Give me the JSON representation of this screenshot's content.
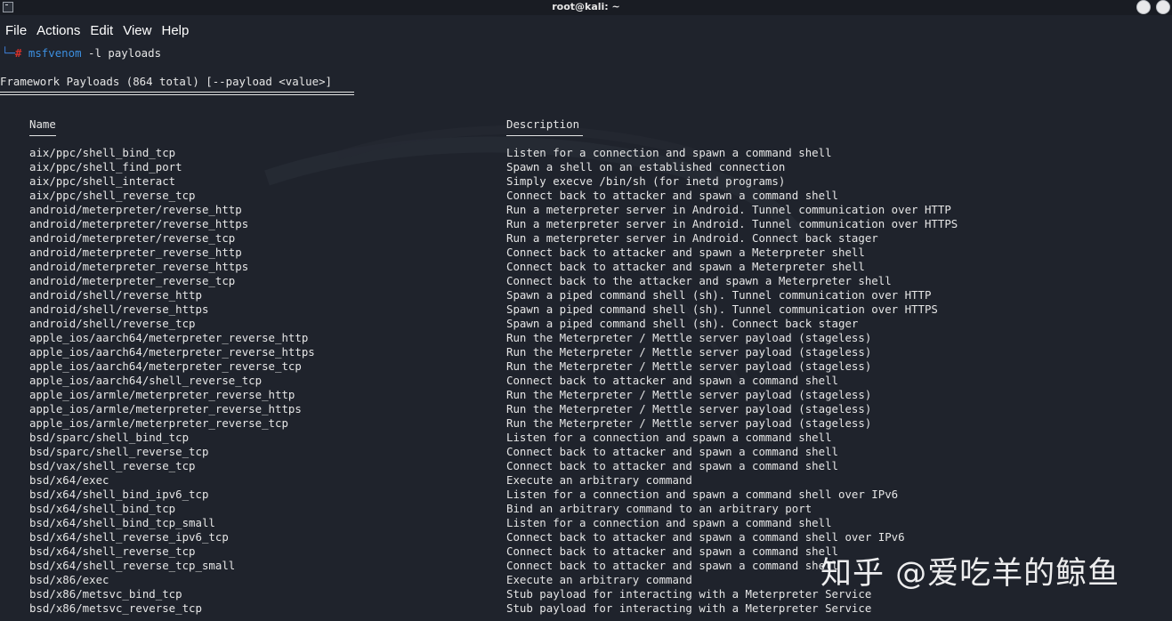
{
  "window": {
    "title": "root@kali: ~"
  },
  "menu": {
    "items": [
      "File",
      "Actions",
      "Edit",
      "View",
      "Help"
    ]
  },
  "prompt": {
    "corner": "└─",
    "hash": "#",
    "command": "msfvenom",
    "args": " -l payloads"
  },
  "output": {
    "heading": "Framework Payloads (864 total) [--payload <value>]",
    "columns": {
      "name": "Name",
      "description": "Description"
    },
    "rows": [
      [
        "aix/ppc/shell_bind_tcp",
        "Listen for a connection and spawn a command shell"
      ],
      [
        "aix/ppc/shell_find_port",
        "Spawn a shell on an established connection"
      ],
      [
        "aix/ppc/shell_interact",
        "Simply execve /bin/sh (for inetd programs)"
      ],
      [
        "aix/ppc/shell_reverse_tcp",
        "Connect back to attacker and spawn a command shell"
      ],
      [
        "android/meterpreter/reverse_http",
        "Run a meterpreter server in Android. Tunnel communication over HTTP"
      ],
      [
        "android/meterpreter/reverse_https",
        "Run a meterpreter server in Android. Tunnel communication over HTTPS"
      ],
      [
        "android/meterpreter/reverse_tcp",
        "Run a meterpreter server in Android. Connect back stager"
      ],
      [
        "android/meterpreter_reverse_http",
        "Connect back to attacker and spawn a Meterpreter shell"
      ],
      [
        "android/meterpreter_reverse_https",
        "Connect back to attacker and spawn a Meterpreter shell"
      ],
      [
        "android/meterpreter_reverse_tcp",
        "Connect back to the attacker and spawn a Meterpreter shell"
      ],
      [
        "android/shell/reverse_http",
        "Spawn a piped command shell (sh). Tunnel communication over HTTP"
      ],
      [
        "android/shell/reverse_https",
        "Spawn a piped command shell (sh). Tunnel communication over HTTPS"
      ],
      [
        "android/shell/reverse_tcp",
        "Spawn a piped command shell (sh). Connect back stager"
      ],
      [
        "apple_ios/aarch64/meterpreter_reverse_http",
        "Run the Meterpreter / Mettle server payload (stageless)"
      ],
      [
        "apple_ios/aarch64/meterpreter_reverse_https",
        "Run the Meterpreter / Mettle server payload (stageless)"
      ],
      [
        "apple_ios/aarch64/meterpreter_reverse_tcp",
        "Run the Meterpreter / Mettle server payload (stageless)"
      ],
      [
        "apple_ios/aarch64/shell_reverse_tcp",
        "Connect back to attacker and spawn a command shell"
      ],
      [
        "apple_ios/armle/meterpreter_reverse_http",
        "Run the Meterpreter / Mettle server payload (stageless)"
      ],
      [
        "apple_ios/armle/meterpreter_reverse_https",
        "Run the Meterpreter / Mettle server payload (stageless)"
      ],
      [
        "apple_ios/armle/meterpreter_reverse_tcp",
        "Run the Meterpreter / Mettle server payload (stageless)"
      ],
      [
        "bsd/sparc/shell_bind_tcp",
        "Listen for a connection and spawn a command shell"
      ],
      [
        "bsd/sparc/shell_reverse_tcp",
        "Connect back to attacker and spawn a command shell"
      ],
      [
        "bsd/vax/shell_reverse_tcp",
        "Connect back to attacker and spawn a command shell"
      ],
      [
        "bsd/x64/exec",
        "Execute an arbitrary command"
      ],
      [
        "bsd/x64/shell_bind_ipv6_tcp",
        "Listen for a connection and spawn a command shell over IPv6"
      ],
      [
        "bsd/x64/shell_bind_tcp",
        "Bind an arbitrary command to an arbitrary port"
      ],
      [
        "bsd/x64/shell_bind_tcp_small",
        "Listen for a connection and spawn a command shell"
      ],
      [
        "bsd/x64/shell_reverse_ipv6_tcp",
        "Connect back to attacker and spawn a command shell over IPv6"
      ],
      [
        "bsd/x64/shell_reverse_tcp",
        "Connect back to attacker and spawn a command shell"
      ],
      [
        "bsd/x64/shell_reverse_tcp_small",
        "Connect back to attacker and spawn a command shell"
      ],
      [
        "bsd/x86/exec",
        "Execute an arbitrary command"
      ],
      [
        "bsd/x86/metsvc_bind_tcp",
        "Stub payload for interacting with a Meterpreter Service"
      ],
      [
        "bsd/x86/metsvc_reverse_tcp",
        "Stub payload for interacting with a Meterpreter Service"
      ]
    ]
  },
  "watermark": {
    "text": "知乎 @爱吃羊的鲸鱼"
  },
  "colors": {
    "background": "#1f232c",
    "text": "#e6e6e6",
    "prompt_blue": "#3c8fe0",
    "prompt_red": "#d3302a"
  }
}
